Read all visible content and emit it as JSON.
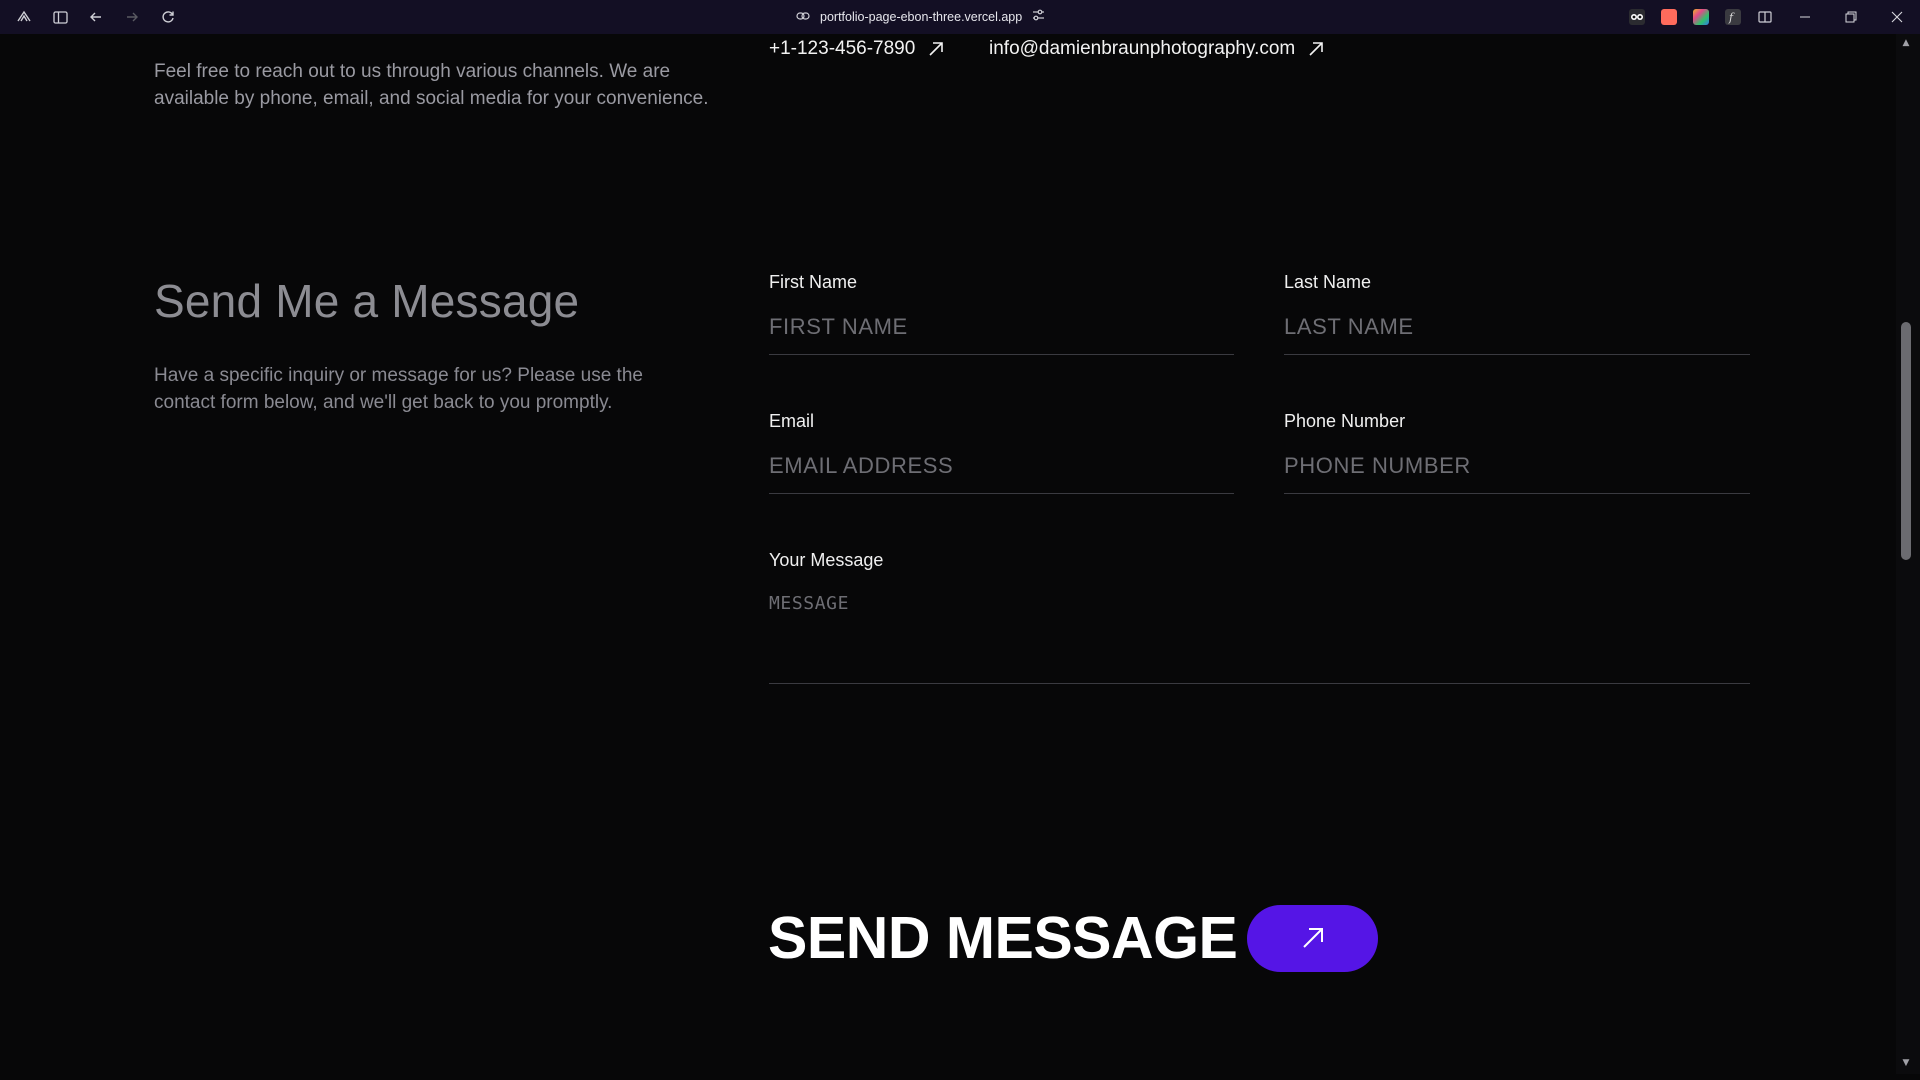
{
  "browser": {
    "url": "portfolio-page-ebon-three.vercel.app",
    "icons": [
      "app-menu-icon",
      "sidebar-toggle-icon",
      "back-icon",
      "forward-icon",
      "reload-icon",
      "link-icon",
      "tune-icon"
    ],
    "extension_colors": [
      "#ff6b5c",
      "#f0b429",
      "#30c36b",
      "#6b6b70"
    ]
  },
  "contact": {
    "phone": "+1-123-456-7890",
    "email": "info@damienbraunphotography.com",
    "intro": "Feel free to reach out to us through various channels. We are available by phone, email, and social media for your convenience."
  },
  "form_section": {
    "title": "Send Me a Message",
    "description": "Have a specific inquiry or message for us? Please use the contact form below, and we'll get back to you promptly.",
    "first_name": {
      "label": "First Name",
      "placeholder": "FIRST NAME"
    },
    "last_name": {
      "label": "Last Name",
      "placeholder": "LAST NAME"
    },
    "email": {
      "label": "Email",
      "placeholder": "EMAIL ADDRESS"
    },
    "phone": {
      "label": "Phone Number",
      "placeholder": "PHONE NUMBER"
    },
    "message": {
      "label": "Your Message",
      "placeholder": "MESSAGE"
    },
    "submit_label": "SEND MESSAGE",
    "accent_color": "#5515e6"
  }
}
